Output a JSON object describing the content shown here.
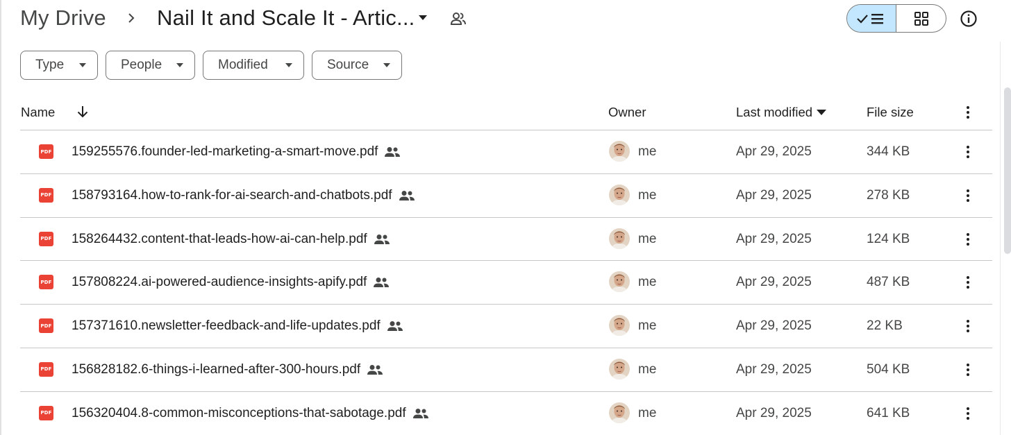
{
  "breadcrumb": {
    "root": "My Drive",
    "current": "Nail It and Scale It - Artic..."
  },
  "filters": {
    "type": "Type",
    "people": "People",
    "modified": "Modified",
    "source": "Source"
  },
  "columns": {
    "name": "Name",
    "owner": "Owner",
    "last_modified": "Last modified",
    "file_size": "File size"
  },
  "files": [
    {
      "name": "159255576.founder-led-marketing-a-smart-move.pdf",
      "owner": "me",
      "modified": "Apr 29, 2025",
      "size": "344 KB"
    },
    {
      "name": "158793164.how-to-rank-for-ai-search-and-chatbots.pdf",
      "owner": "me",
      "modified": "Apr 29, 2025",
      "size": "278 KB"
    },
    {
      "name": "158264432.content-that-leads-how-ai-can-help.pdf",
      "owner": "me",
      "modified": "Apr 29, 2025",
      "size": "124 KB"
    },
    {
      "name": "157808224.ai-powered-audience-insights-apify.pdf",
      "owner": "me",
      "modified": "Apr 29, 2025",
      "size": "487 KB"
    },
    {
      "name": "157371610.newsletter-feedback-and-life-updates.pdf",
      "owner": "me",
      "modified": "Apr 29, 2025",
      "size": "22 KB"
    },
    {
      "name": "156828182.6-things-i-learned-after-300-hours.pdf",
      "owner": "me",
      "modified": "Apr 29, 2025",
      "size": "504 KB"
    },
    {
      "name": "156320404.8-common-misconceptions-that-sabotage.pdf",
      "owner": "me",
      "modified": "Apr 29, 2025",
      "size": "641 KB"
    }
  ],
  "file_icon_label": "PDF",
  "icons": {
    "breadcrumb_separator": "chevron-right-icon",
    "folder_dropdown": "caret-down-icon",
    "shared_folder": "people-outline-icon",
    "list_view": "check-list-icon",
    "grid_view": "grid-icon",
    "details": "info-icon",
    "sort": "arrow-down-icon",
    "more": "more-vert-icon",
    "shared_file": "people-icon",
    "file_type": "pdf-icon"
  },
  "colors": {
    "accent": "#c2e7ff",
    "pdf": "#ea4335",
    "text": "#1f1f1f",
    "secondary_text": "#444746",
    "border": "#747775",
    "divider": "#c4c7c5"
  }
}
